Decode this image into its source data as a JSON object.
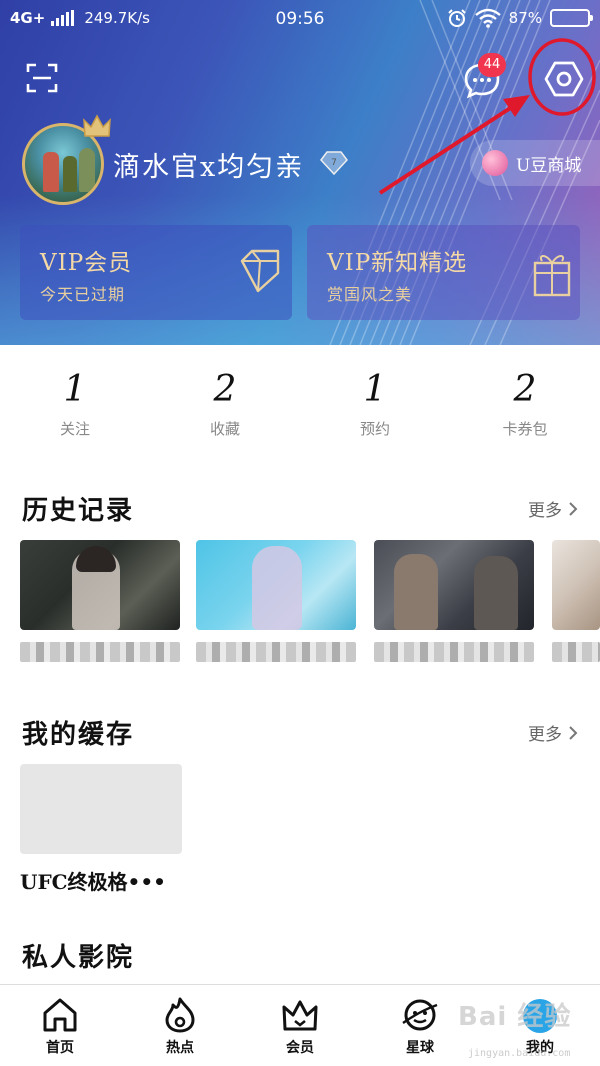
{
  "status_bar": {
    "network": "4G+",
    "speed": "249.7K/s",
    "time": "09:56",
    "battery_percent": "87%",
    "battery_level": 0.87
  },
  "header": {
    "message_badge": "44",
    "username": "滴水官x均匀亲",
    "mall_label": "U豆商城"
  },
  "vip_cards": [
    {
      "title": "VIP会员",
      "subtitle": "今天已过期"
    },
    {
      "title": "VIP新知精选",
      "subtitle": "赏国风之美"
    }
  ],
  "stats": [
    {
      "value": "1",
      "label": "关注"
    },
    {
      "value": "2",
      "label": "收藏"
    },
    {
      "value": "1",
      "label": "预约"
    },
    {
      "value": "2",
      "label": "卡券包"
    }
  ],
  "history": {
    "title": "历史记录",
    "more": "更多"
  },
  "cache": {
    "title": "我的缓存",
    "more": "更多",
    "item_title": "UFC终极格•••"
  },
  "cinema": {
    "title": "私人影院"
  },
  "nav": [
    {
      "label": "首页",
      "icon": "home-icon"
    },
    {
      "label": "热点",
      "icon": "flame-icon"
    },
    {
      "label": "会员",
      "icon": "crown-icon"
    },
    {
      "label": "星球",
      "icon": "planet-icon"
    },
    {
      "label": "我的",
      "icon": "profile-icon"
    }
  ],
  "colors": {
    "accent_red": "#e0182c",
    "badge": "#f2354f",
    "vip_gold": "#f4d9a6",
    "active_tab": "#29a4e6"
  }
}
